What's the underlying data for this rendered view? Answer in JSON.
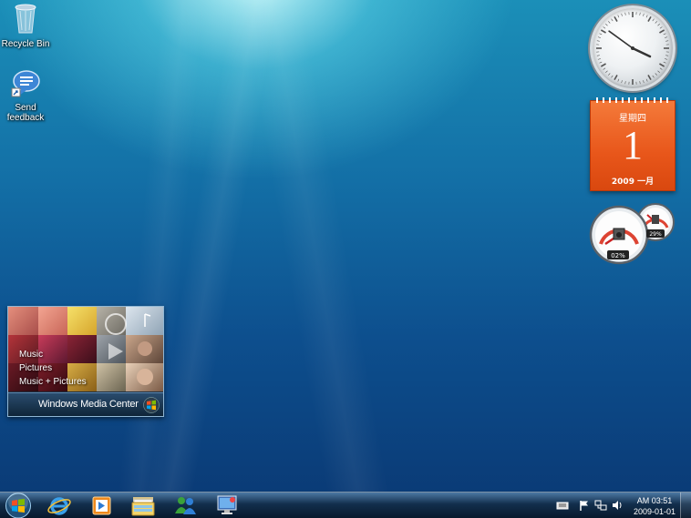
{
  "desktop": {
    "icons": [
      {
        "label": "Recycle Bin",
        "icon": "recycle-bin-icon"
      },
      {
        "label": "Send feedback",
        "icon": "send-feedback-icon"
      }
    ]
  },
  "gadgets": {
    "clock": {
      "hour": 3,
      "minute": 51
    },
    "calendar": {
      "weekday": "星期四",
      "day": "1",
      "month_year": "2009 一月"
    },
    "cpu_meter": {
      "cpu_percent": "02%",
      "memory_percent": "29%"
    },
    "media_center": {
      "menu": [
        "Music",
        "Pictures",
        "Music + Pictures"
      ],
      "title": "Windows Media Center"
    }
  },
  "taskbar": {
    "pinned": [
      {
        "name": "internet-explorer",
        "icon": "internet-explorer-icon"
      },
      {
        "name": "media-player",
        "icon": "media-player-icon"
      },
      {
        "name": "windows-explorer",
        "icon": "folder-library-icon"
      },
      {
        "name": "windows-live-messenger",
        "icon": "messenger-icon"
      },
      {
        "name": "remote-desktop",
        "icon": "remote-desktop-icon"
      }
    ],
    "tray_icons": [
      "keyboard-icon",
      "action-center-flag-icon",
      "network-icon",
      "volume-icon"
    ],
    "clock": {
      "time": "AM 03:51",
      "date": "2009-01-01"
    }
  },
  "colors": {
    "desktop_blue": "#0d4f8e",
    "calendar_orange": "#e8561a"
  }
}
